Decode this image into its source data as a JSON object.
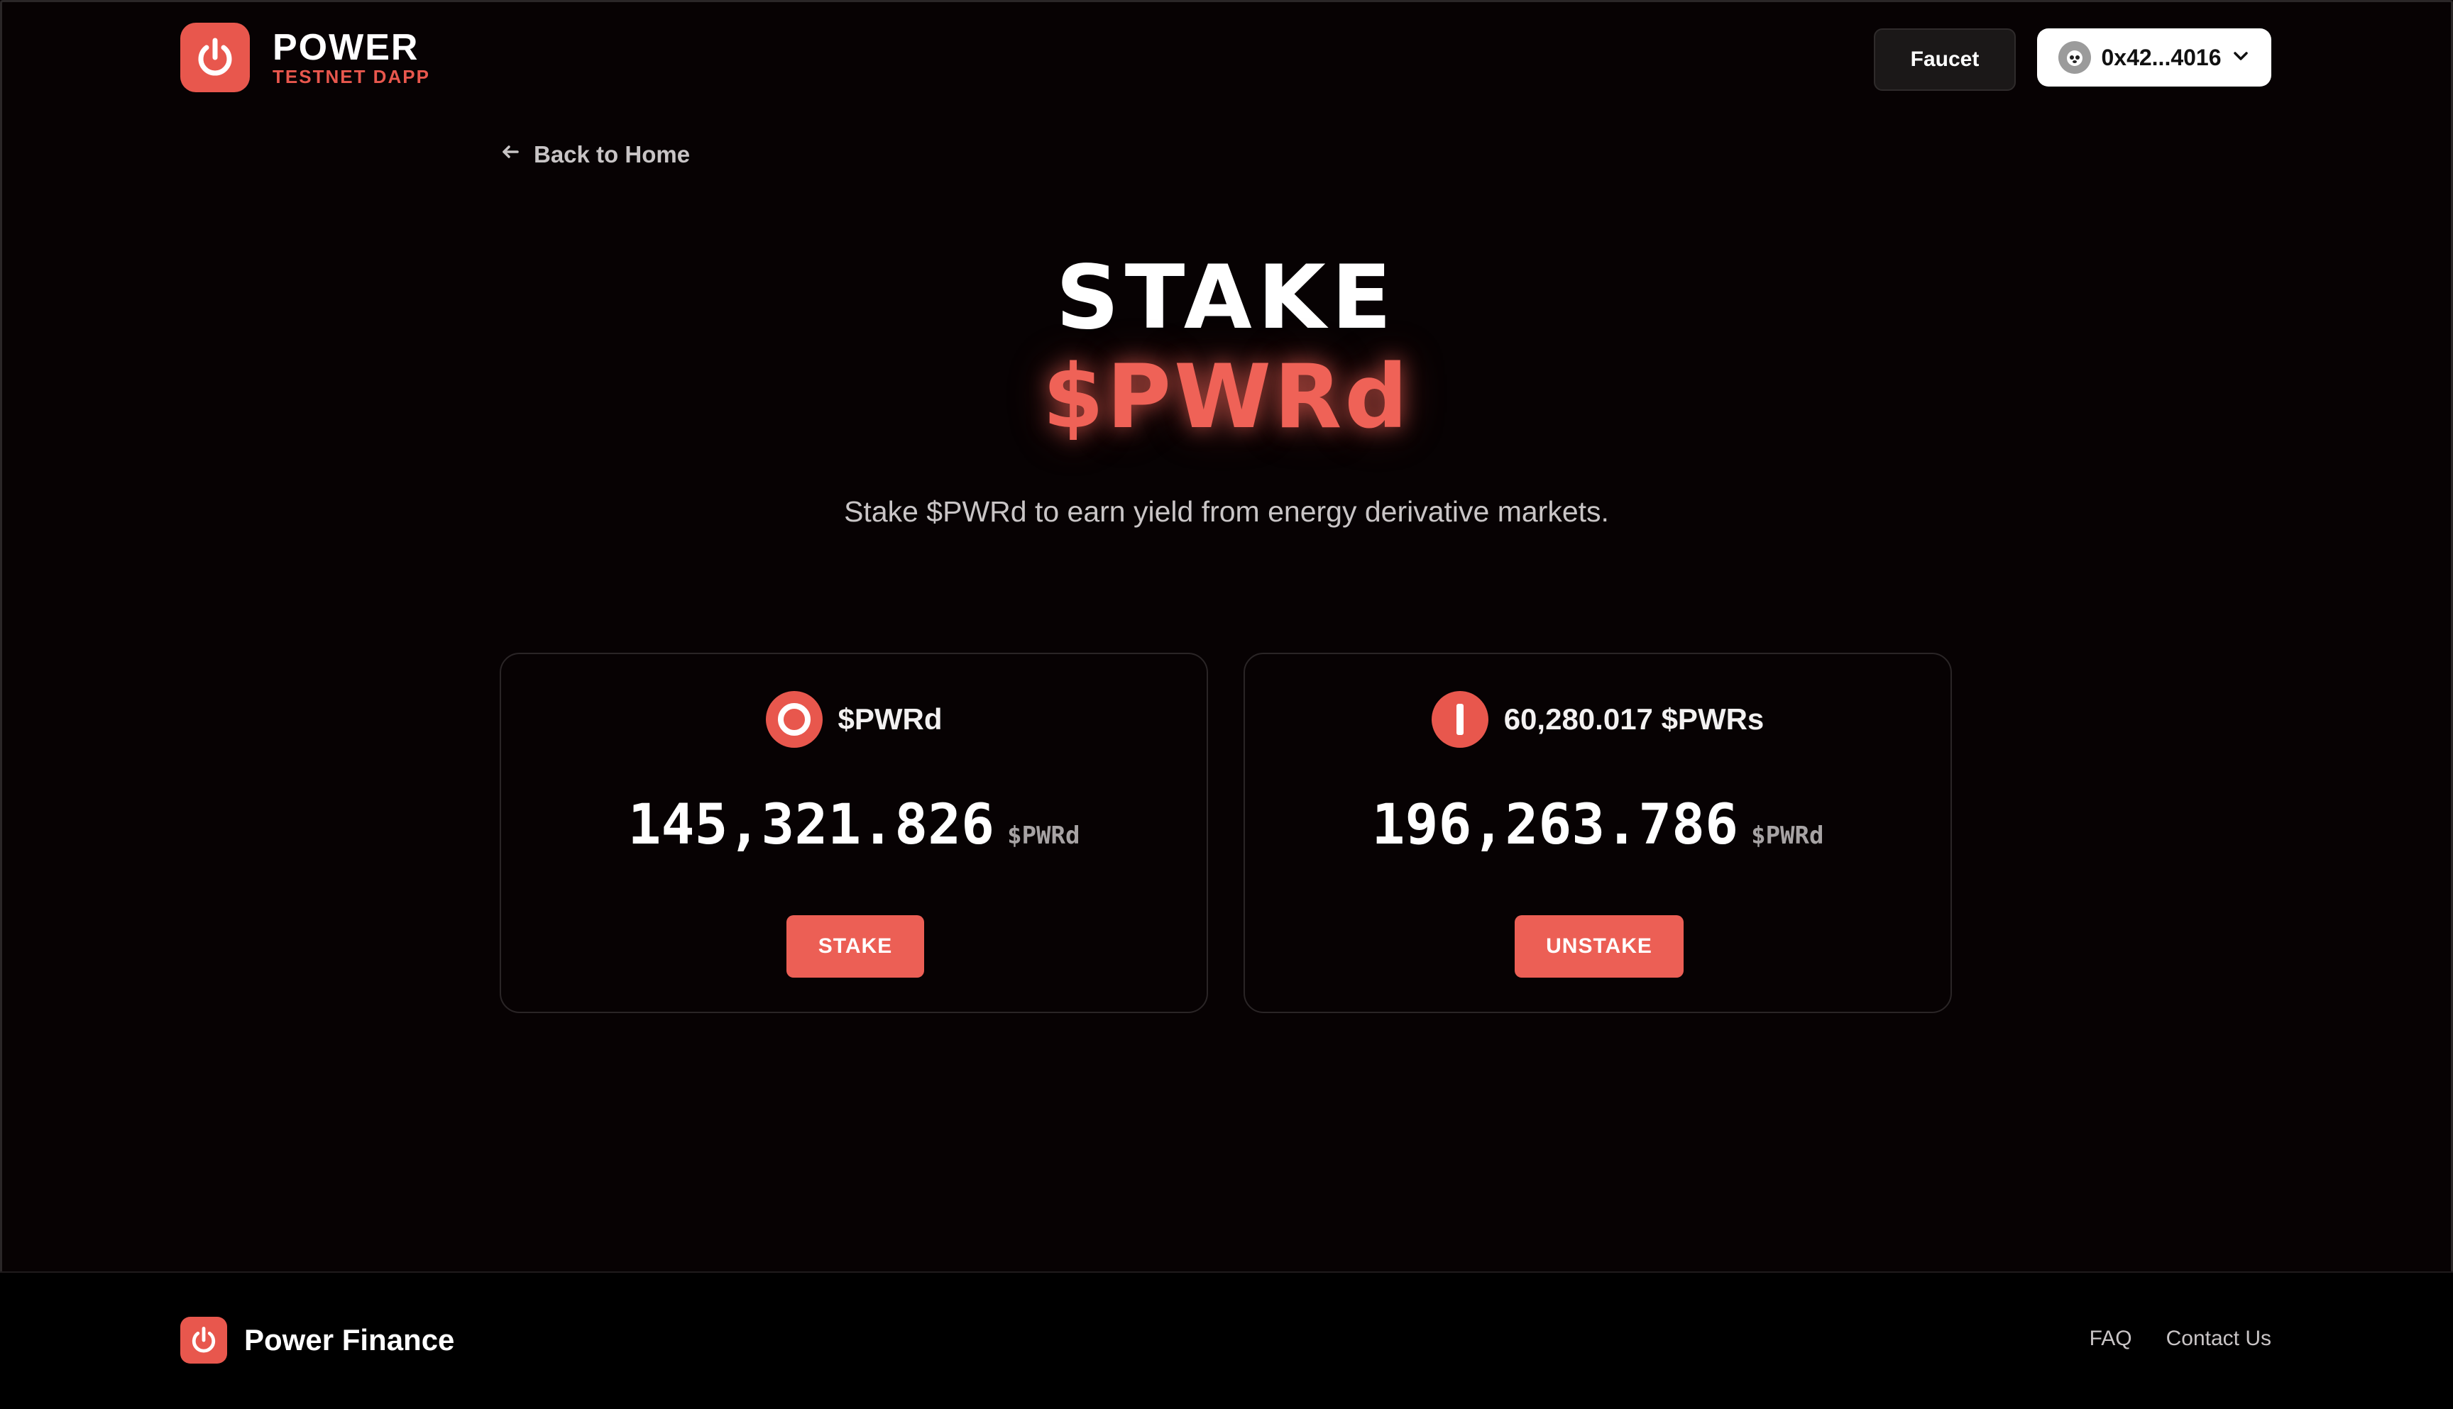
{
  "header": {
    "brand_title": "POWER",
    "brand_subtitle": "TESTNET DAPP",
    "faucet_label": "Faucet",
    "wallet_address": "0x42...4016"
  },
  "nav": {
    "back_label": "Back to Home"
  },
  "hero": {
    "title": "STAKE",
    "token": "$PWRd",
    "description": "Stake $PWRd to earn yield from energy derivative markets."
  },
  "cards": {
    "stake": {
      "token_label": "$PWRd",
      "amount": "145,321.826",
      "unit": "$PWRd",
      "button_label": "STAKE"
    },
    "unstake": {
      "token_label": "60,280.017 $PWRs",
      "amount": "196,263.786",
      "unit": "$PWRd",
      "button_label": "UNSTAKE"
    }
  },
  "footer": {
    "brand": "Power Finance",
    "links": [
      "FAQ",
      "Contact Us"
    ]
  },
  "colors": {
    "accent": "#e8574d",
    "background": "#070203",
    "button": "#ec5f55"
  },
  "icons": {
    "logo": "power-icon",
    "wallet": "avatar-icon",
    "back": "arrow-left-icon",
    "stake_token": "ring-icon",
    "unstake_token": "bar-icon",
    "dropdown": "chevron-down-icon"
  }
}
